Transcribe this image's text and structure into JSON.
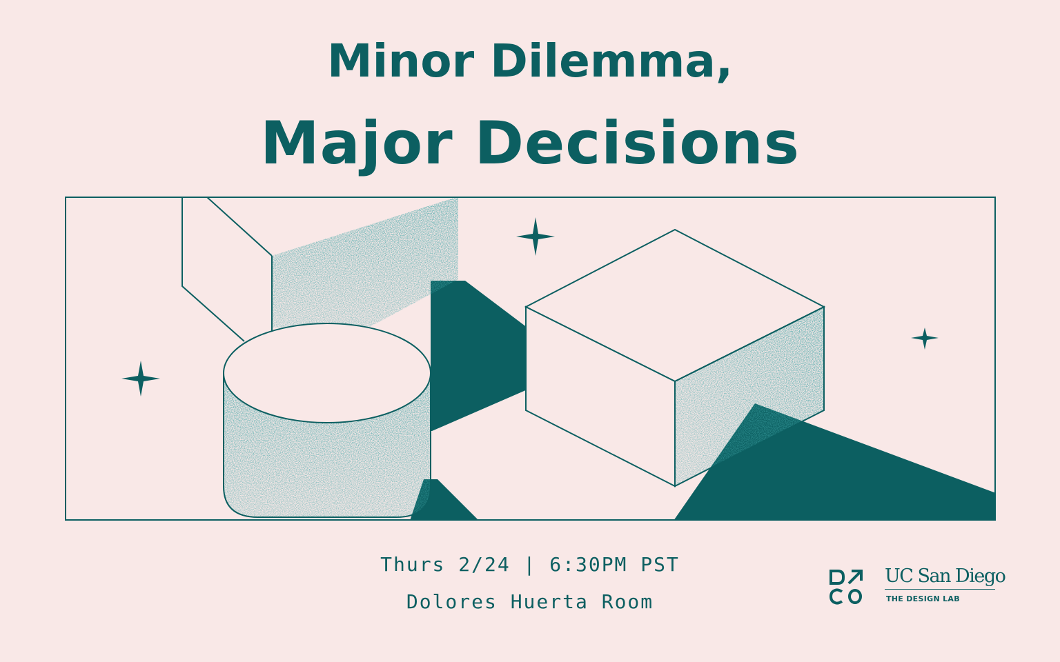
{
  "title": {
    "line1": "Minor Dilemma,",
    "line2": "Major Decisions"
  },
  "event": {
    "date_time": "Thurs 2/24 | 6:30PM PST",
    "location": "Dolores Huerta Room"
  },
  "logos": {
    "dco_mark": "D ↗ C O",
    "ucsd_wordmark": "UC San Diego",
    "ucsd_sub": "THE DESIGN LAB"
  },
  "colors": {
    "background": "#f9e8e7",
    "accent": "#0c5f61"
  },
  "icons": [
    "sparkle-icon",
    "dco-logo-icon",
    "arrow-up-right-icon"
  ]
}
